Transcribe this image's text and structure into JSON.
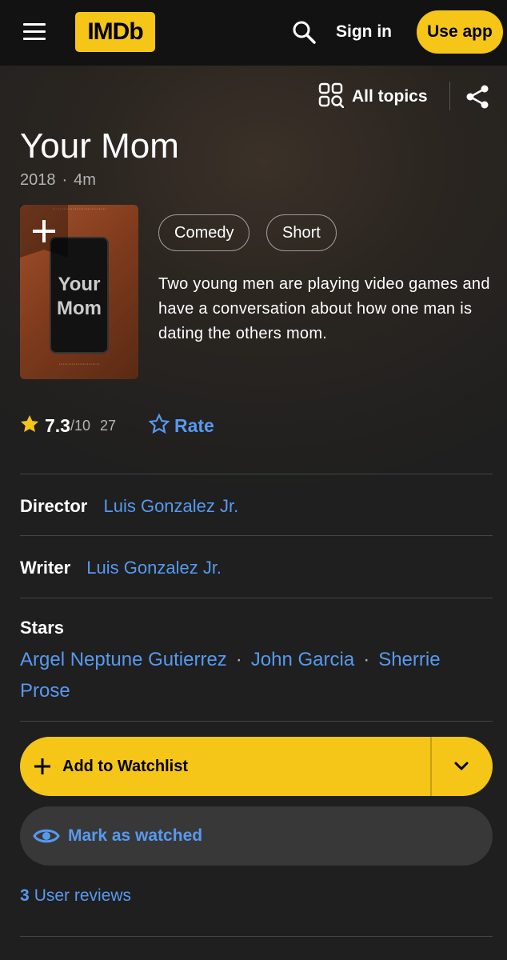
{
  "header": {
    "logo_text": "IMDb",
    "signin_label": "Sign in",
    "useapp_label": "Use app"
  },
  "toolbar": {
    "alltopics_label": "All topics"
  },
  "title": {
    "name": "Your Mom",
    "year": "2018",
    "runtime": "4m"
  },
  "poster": {
    "text_line1": "Your",
    "text_line2": "Mom"
  },
  "genres": [
    "Comedy",
    "Short"
  ],
  "plot": "Two young men are playing video games and have a conversation about how one man is dating the others mom.",
  "rating": {
    "value": "7.3",
    "out_of": "/10",
    "count": "27",
    "rate_label": "Rate"
  },
  "credits": {
    "director_role": "Director",
    "director_name": "Luis Gonzalez Jr.",
    "writer_role": "Writer",
    "writer_name": "Luis Gonzalez Jr.",
    "stars_role": "Stars",
    "stars": [
      "Argel Neptune Gutierrez",
      "John Garcia",
      "Sherrie Prose"
    ]
  },
  "actions": {
    "watchlist_label": "Add to Watchlist",
    "watched_label": "Mark as watched"
  },
  "reviews": {
    "count": "3",
    "label": "User reviews"
  },
  "colors": {
    "accent_yellow": "#f5c518",
    "link_blue": "#5799ef",
    "star_gold": "#f5c518"
  }
}
